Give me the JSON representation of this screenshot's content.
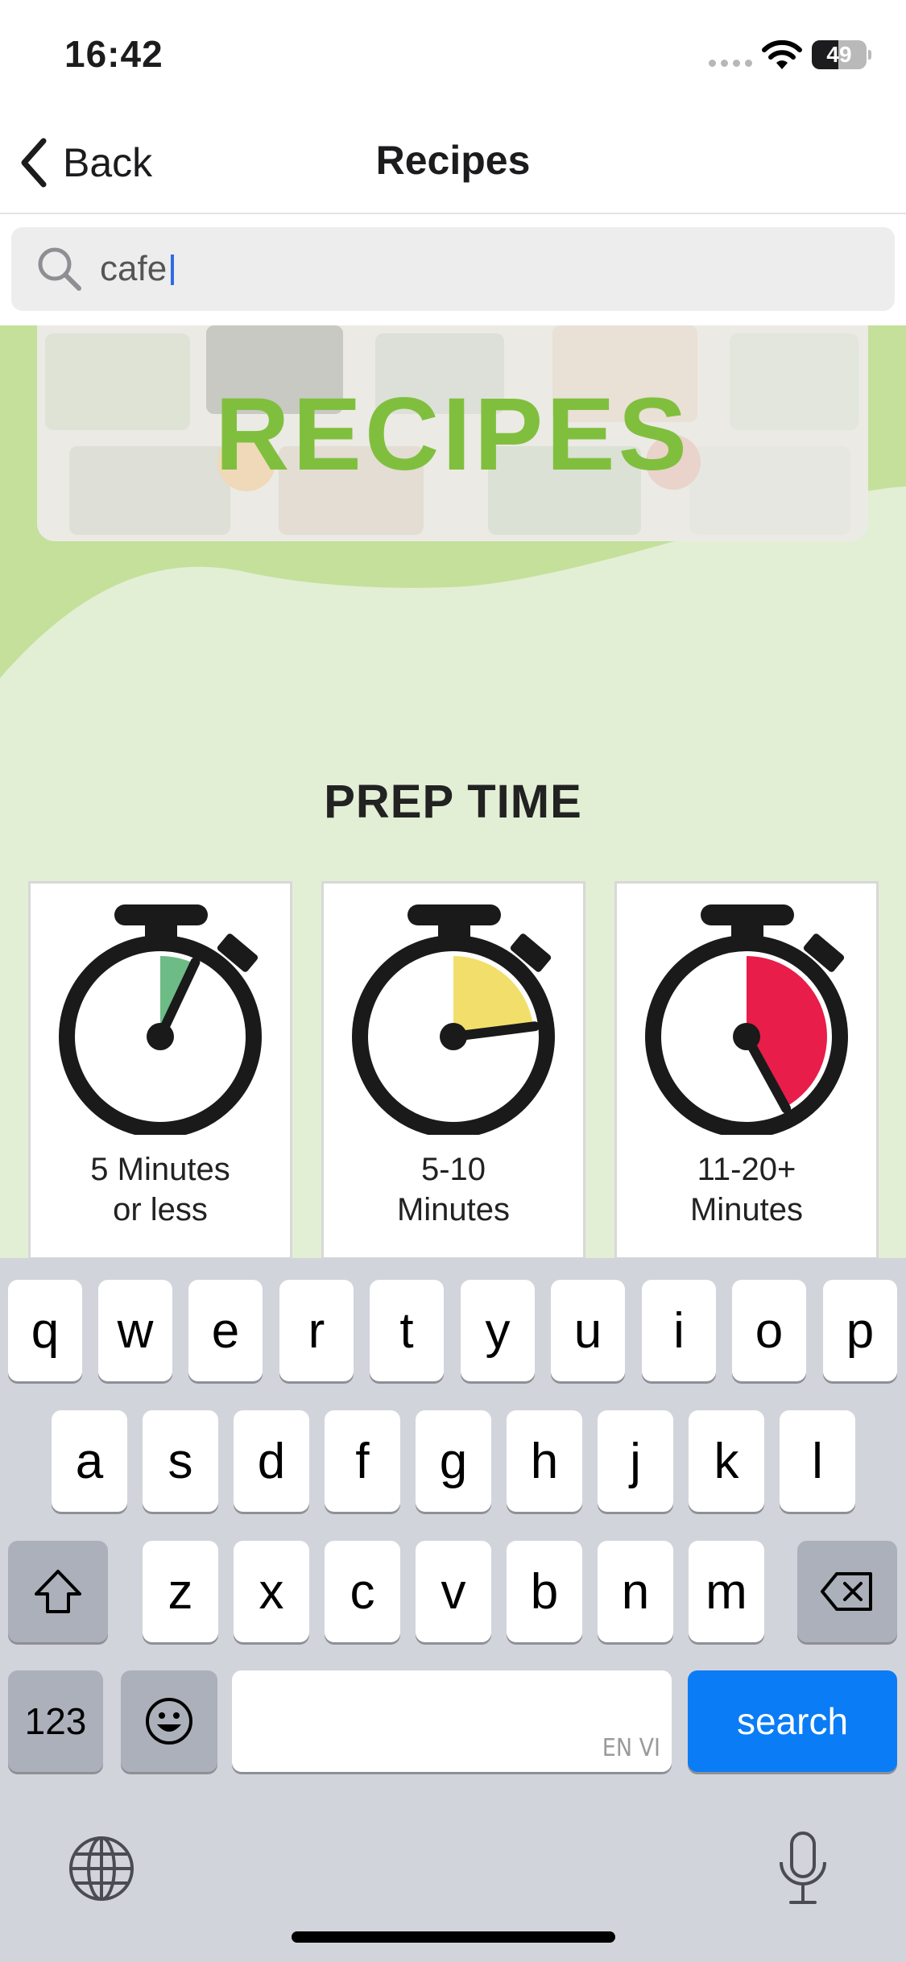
{
  "status_bar": {
    "time": "16:42",
    "battery": "49",
    "battery_level": 0.49
  },
  "nav": {
    "back_label": "Back",
    "title": "Recipes"
  },
  "search": {
    "value": "cafe",
    "placeholder": ""
  },
  "banner": {
    "title": "RECIPES"
  },
  "prep_time": {
    "title": "PREP TIME",
    "cards": [
      {
        "line1": "5 Minutes",
        "line2": "or less",
        "color": "#6dbb85",
        "fill_fraction": 0.07
      },
      {
        "line1": "5-10",
        "line2": "Minutes",
        "color": "#f2df6b",
        "fill_fraction": 0.23
      },
      {
        "line1": "11-20+",
        "line2": "Minutes",
        "color": "#e81d4a",
        "fill_fraction": 0.42
      }
    ]
  },
  "keyboard": {
    "row1": [
      "q",
      "w",
      "e",
      "r",
      "t",
      "y",
      "u",
      "i",
      "o",
      "p"
    ],
    "row2": [
      "a",
      "s",
      "d",
      "f",
      "g",
      "h",
      "j",
      "k",
      "l"
    ],
    "row3": [
      "z",
      "x",
      "c",
      "v",
      "b",
      "n",
      "m"
    ],
    "numbers_label": "123",
    "space_lang_hint": "EN VI",
    "search_label": "search"
  },
  "colors": {
    "accent_green": "#80bf3e",
    "content_bg": "#e2efd5",
    "keyboard_search": "#0a7cf5"
  }
}
